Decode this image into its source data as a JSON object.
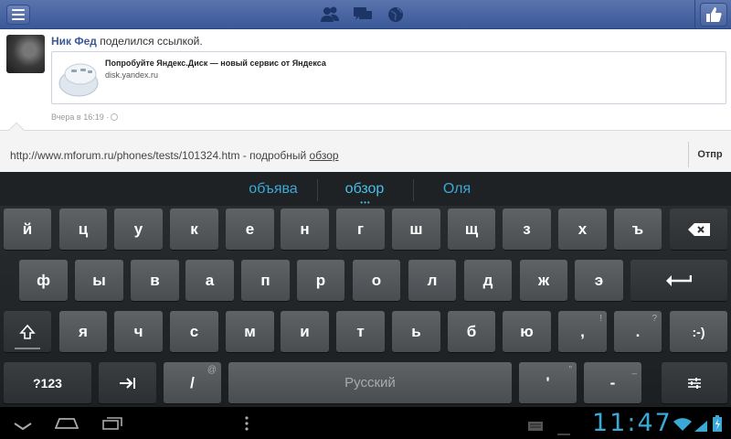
{
  "post": {
    "author": "Ник Фед",
    "action": "поделился ссылкой.",
    "link_title": "Попробуйте Яндекс.Диск — новый сервис от Яндекса",
    "link_url": "disk.yandex.ru",
    "time": "Вчера в 16:19 ·"
  },
  "share": {
    "text_prefix": "http://www.mforum.ru/phones/tests/101324.htm - подробный ",
    "text_underlined": "обзор",
    "send_label": "Отпр"
  },
  "keyboard": {
    "suggestions": [
      "объява",
      "обзор",
      "Оля"
    ],
    "row1": [
      "й",
      "ц",
      "у",
      "к",
      "е",
      "н",
      "г",
      "ш",
      "щ",
      "з",
      "х",
      "ъ"
    ],
    "row2": [
      "ф",
      "ы",
      "в",
      "а",
      "п",
      "р",
      "о",
      "л",
      "д",
      "ж",
      "э"
    ],
    "row3": [
      "я",
      "ч",
      "с",
      "м",
      "и",
      "т",
      "ь",
      "б",
      "ю"
    ],
    "row3_punct": [
      ",",
      "."
    ],
    "row3_punct_sub": [
      "!",
      "?"
    ],
    "smiley": ":-)",
    "sym_label": "?123",
    "slash": "/",
    "slash_sub": "@",
    "space_label": "Русский",
    "apostrophe": "'",
    "apostrophe_sub": "\"",
    "dash": "-",
    "dash_sub": "_"
  },
  "status": {
    "time": "11:47"
  },
  "colors": {
    "accent": "#3aa9d5",
    "fb_blue": "#3b5998"
  }
}
